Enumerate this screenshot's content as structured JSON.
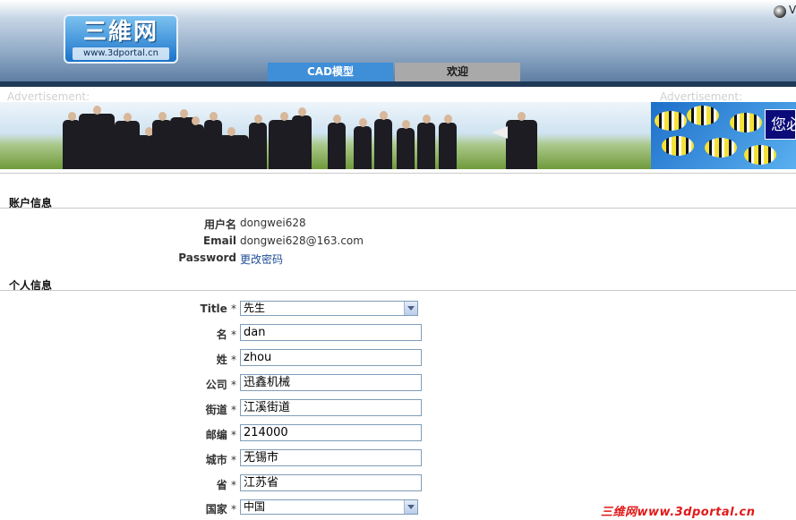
{
  "header": {
    "logo": {
      "title": "三維网",
      "url": "www.3dportal.cn"
    },
    "top_right_text": "V",
    "tabs": [
      {
        "label": "CAD模型",
        "active": true
      },
      {
        "label": "欢迎",
        "active": false
      }
    ]
  },
  "ads": {
    "left_label": "Advertisement:",
    "right_label": "Advertisement:",
    "right_banner_text": "您必"
  },
  "account": {
    "section_title": "账户信息",
    "rows": [
      {
        "label": "用户名",
        "value": "dongwei628"
      },
      {
        "label": "Email",
        "value": "dongwei628@163.com"
      },
      {
        "label": "Password",
        "value": "更改密码"
      }
    ]
  },
  "personal": {
    "section_title": "个人信息",
    "required_mark": "*",
    "fields": {
      "title": {
        "label": "Title",
        "value": "先生"
      },
      "first_name": {
        "label": "名",
        "value": "dan"
      },
      "last_name": {
        "label": "姓",
        "value": "zhou"
      },
      "company": {
        "label": "公司",
        "value": "迅鑫机械"
      },
      "street": {
        "label": "街道",
        "value": "江溪街道"
      },
      "postcode": {
        "label": "邮编",
        "value": "214000"
      },
      "city": {
        "label": "城市",
        "value": "无锡市"
      },
      "province": {
        "label": "省",
        "value": "江苏省"
      },
      "country": {
        "label": "国家",
        "value": "中国"
      }
    }
  },
  "watermark": "三维网www.3dportal.cn",
  "colors": {
    "tab_active": "#3e8ed8",
    "tab_inactive": "#a9a9a9",
    "header_dark": "#1f3a58",
    "link": "#1f4e96",
    "watermark": "#e01919"
  }
}
